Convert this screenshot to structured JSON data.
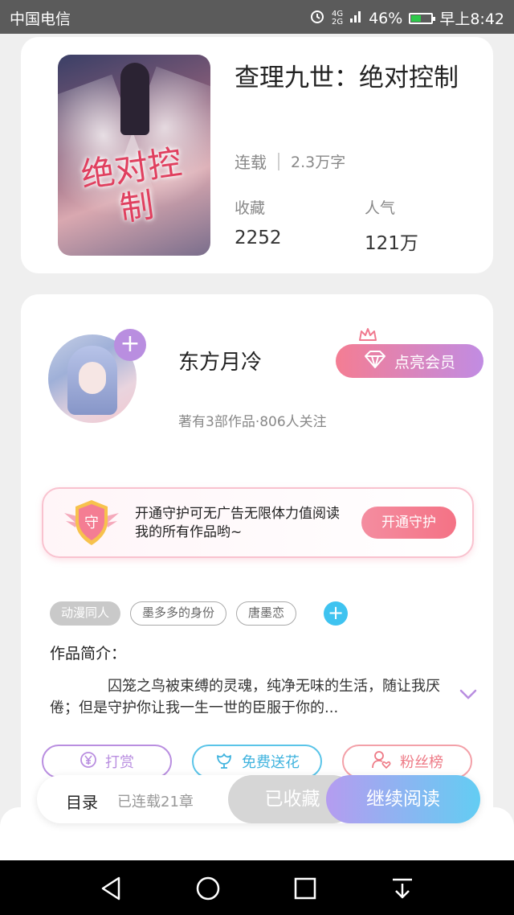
{
  "status_bar": {
    "carrier": "中国电信",
    "network_top": "4G",
    "network_bottom": "2G",
    "battery": "46%",
    "time": "早上8:42",
    "battery_level": 0.46
  },
  "book": {
    "cover_title": "绝对控制",
    "title": "查理九世：绝对控制",
    "status": "连载",
    "word_count": "2.3万字",
    "stats": [
      {
        "label": "收藏",
        "value": "2252"
      },
      {
        "label": "人气",
        "value": "121万"
      }
    ]
  },
  "author": {
    "name": "东方月冷",
    "info": "著有3部作品·806人关注",
    "follow_icon": "plus-icon",
    "vip_button": "点亮会员"
  },
  "guard": {
    "shield_char": "守",
    "text": "开通守护可无广告无限体力值阅读我的所有作品哟~",
    "button": "开通守护"
  },
  "tags": [
    {
      "label": "动漫同人",
      "style": "filled"
    },
    {
      "label": "墨多多的身份",
      "style": "outline"
    },
    {
      "label": "唐墨恋",
      "style": "outline"
    }
  ],
  "intro": {
    "label": "作品简介：",
    "text": "囚笼之鸟被束缚的灵魂，纯净无味的生活，随让我厌倦；但是守护你让我一生一世的臣服于你的..."
  },
  "actions": {
    "tip": "打赏",
    "flower": "免费送花",
    "fans": "粉丝榜"
  },
  "bottom_bar": {
    "toc_label": "目录",
    "toc_count": "已连载21章",
    "collected": "已收藏",
    "read": "继续阅读"
  },
  "colors": {
    "purple": "#b98ee0",
    "pink": "#f47d93",
    "blue": "#63cdf3",
    "battery_green": "#2ec84a"
  }
}
